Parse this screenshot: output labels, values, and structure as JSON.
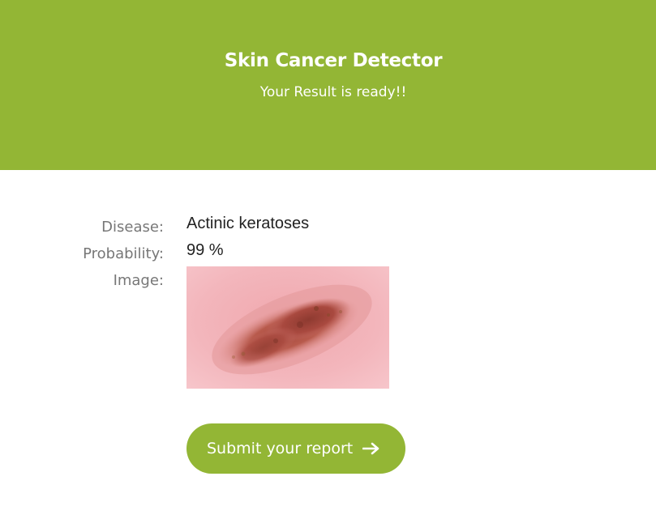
{
  "header": {
    "title": "Skin Cancer Detector",
    "subtitle": "Your Result is ready!!",
    "color": "#93b635"
  },
  "result": {
    "disease_label": "Disease:",
    "disease_value": "Actinic keratoses",
    "probability_label": "Probability:",
    "probability_value": "99 %",
    "image_label": "Image:"
  },
  "submit": {
    "label": "Submit your report",
    "icon": "arrow-right-icon"
  }
}
